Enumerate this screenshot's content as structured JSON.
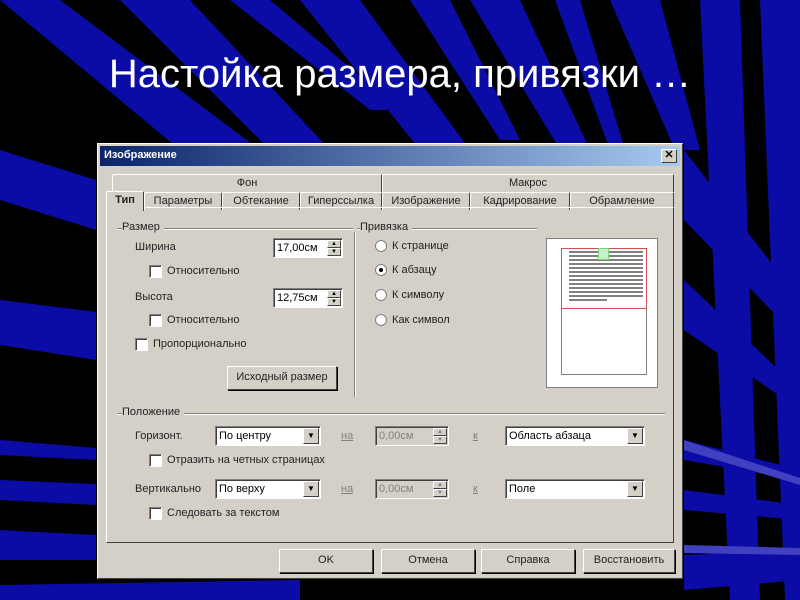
{
  "slide": {
    "title": "Настойка размера, привязки …",
    "colors": {
      "background": "#000000",
      "stripes": "#0a0aa8",
      "title_text": "#ffffff"
    }
  },
  "dialog": {
    "title": "Изображение",
    "close_icon": "close-icon",
    "tabs_row1": [
      {
        "label": "Фон"
      },
      {
        "label": "Макрос"
      }
    ],
    "tabs_row2": [
      {
        "label": "Тип",
        "active": true
      },
      {
        "label": "Параметры"
      },
      {
        "label": "Обтекание"
      },
      {
        "label": "Гиперссылка"
      },
      {
        "label": "Изображение"
      },
      {
        "label": "Кадрирование"
      },
      {
        "label": "Обрамление"
      }
    ],
    "size": {
      "group_label": "Размер",
      "width_label": "Ширина",
      "width_value": "17,00см",
      "width_relative_label": "Относительно",
      "width_relative_checked": false,
      "height_label": "Высота",
      "height_value": "12,75см",
      "height_relative_label": "Относительно",
      "height_relative_checked": false,
      "proportional_label": "Пропорционально",
      "proportional_checked": false,
      "original_size_button": "Исходный размер"
    },
    "anchor": {
      "group_label": "Привязка",
      "options": [
        {
          "label": "К странице",
          "selected": false
        },
        {
          "label": "К абзацу",
          "selected": true
        },
        {
          "label": "К символу",
          "selected": false
        },
        {
          "label": "Как символ",
          "selected": false
        }
      ]
    },
    "position": {
      "group_label": "Положение",
      "horizontal_label": "Горизонт.",
      "horizontal_value": "По центру",
      "horizontal_by_label": "на",
      "horizontal_by_value": "0,00см",
      "horizontal_to_label": "к",
      "horizontal_to_value": "Область абзаца",
      "mirror_label": "Отразить на четных страницах",
      "mirror_checked": false,
      "vertical_label": "Вертикально",
      "vertical_value": "По верху",
      "vertical_by_label": "на",
      "vertical_by_value": "0,00см",
      "vertical_to_label": "к",
      "vertical_to_value": "Поле",
      "follow_text_label": "Следовать за текстом",
      "follow_text_checked": false
    },
    "buttons": {
      "ok": "OK",
      "cancel": "Отмена",
      "help": "Справка",
      "reset": "Восстановить"
    }
  }
}
